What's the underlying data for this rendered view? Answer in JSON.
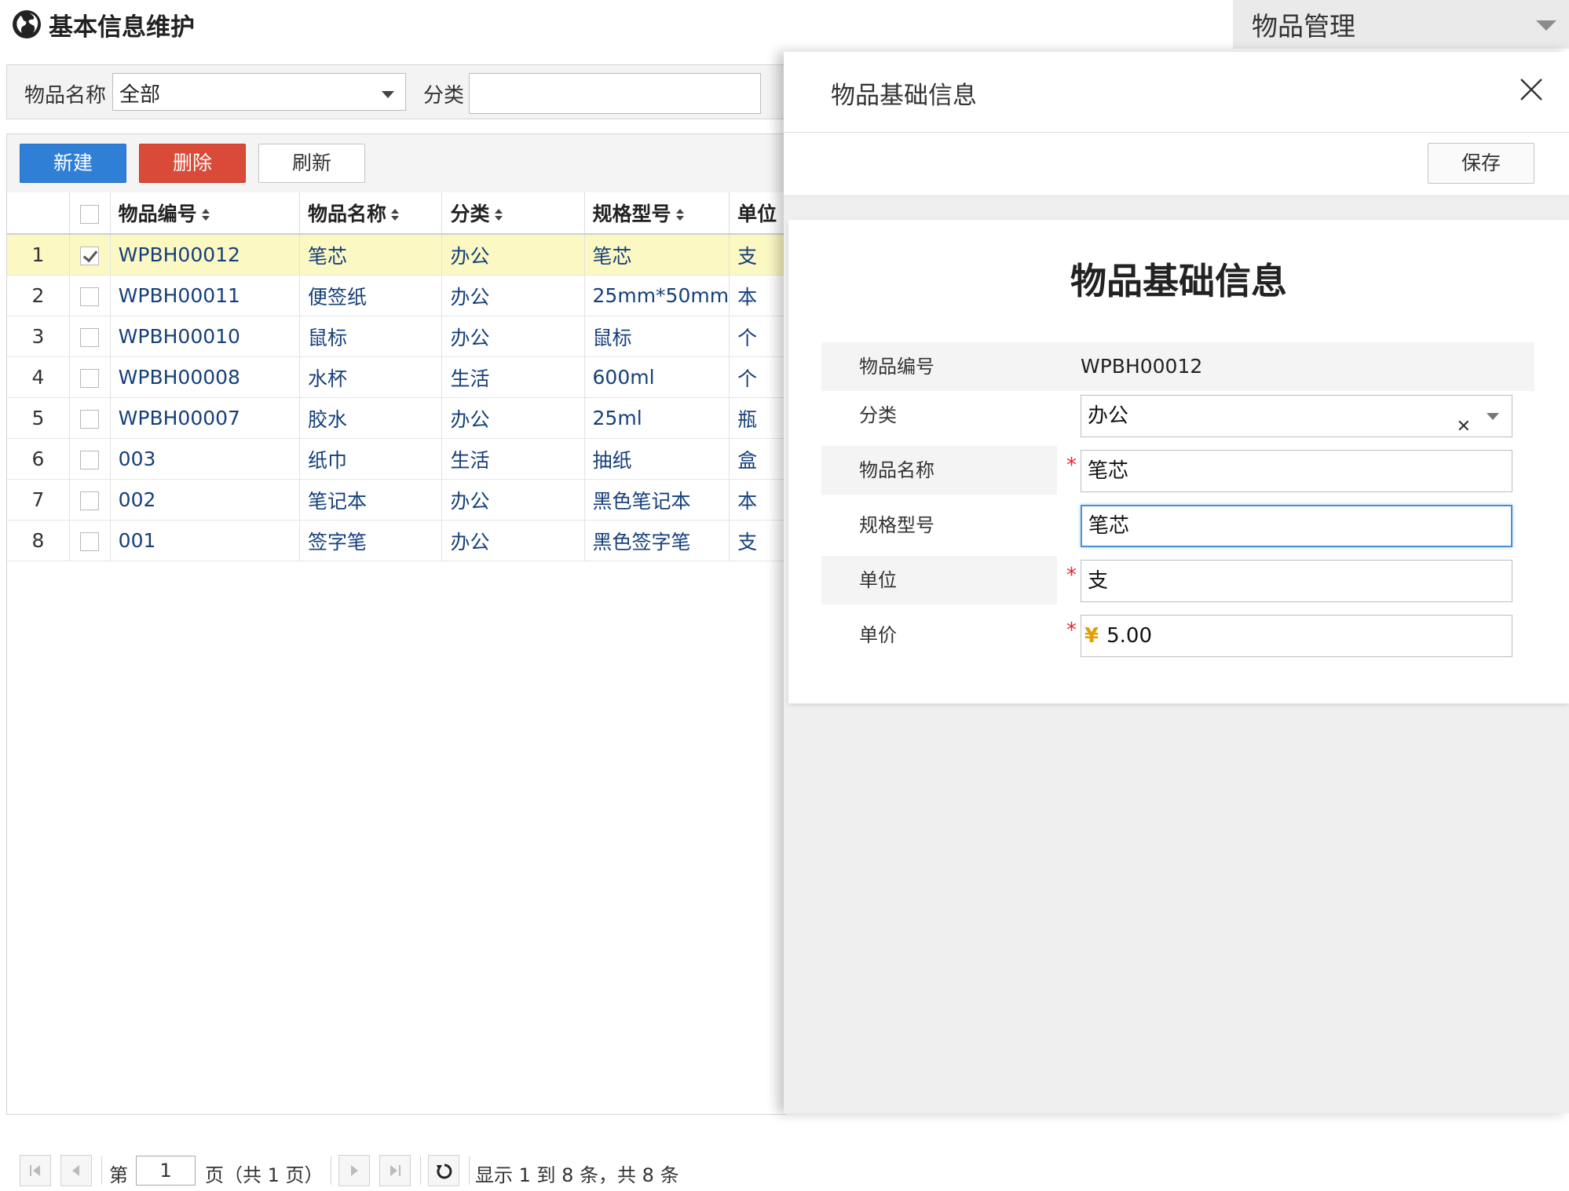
{
  "header": {
    "page_title": "基本信息维护",
    "module_select": "物品管理"
  },
  "filter": {
    "name_label": "物品名称",
    "name_value": "全部",
    "category_label": "分类",
    "category_value": ""
  },
  "toolbar": {
    "new_label": "新建",
    "delete_label": "删除",
    "refresh_label": "刷新"
  },
  "grid": {
    "columns": [
      "物品编号",
      "物品名称",
      "分类",
      "规格型号",
      "单位"
    ],
    "rows": [
      {
        "num": "1",
        "checked": true,
        "code": "WPBH00012",
        "name": "笔芯",
        "category": "办公",
        "spec": "笔芯",
        "unit": "支"
      },
      {
        "num": "2",
        "checked": false,
        "code": "WPBH00011",
        "name": "便签纸",
        "category": "办公",
        "spec": "25mm*50mm",
        "unit": "本"
      },
      {
        "num": "3",
        "checked": false,
        "code": "WPBH00010",
        "name": "鼠标",
        "category": "办公",
        "spec": "鼠标",
        "unit": "个"
      },
      {
        "num": "4",
        "checked": false,
        "code": "WPBH00008",
        "name": "水杯",
        "category": "生活",
        "spec": "600ml",
        "unit": "个"
      },
      {
        "num": "5",
        "checked": false,
        "code": "WPBH00007",
        "name": "胶水",
        "category": "办公",
        "spec": "25ml",
        "unit": "瓶"
      },
      {
        "num": "6",
        "checked": false,
        "code": "003",
        "name": "纸巾",
        "category": "生活",
        "spec": "抽纸",
        "unit": "盒"
      },
      {
        "num": "7",
        "checked": false,
        "code": "002",
        "name": "笔记本",
        "category": "办公",
        "spec": "黑色笔记本",
        "unit": "本"
      },
      {
        "num": "8",
        "checked": false,
        "code": "001",
        "name": "签字笔",
        "category": "办公",
        "spec": "黑色签字笔",
        "unit": "支"
      }
    ]
  },
  "pager": {
    "page_prefix": "第",
    "page_value": "1",
    "page_suffix": "页（共 1 页）",
    "summary": "显示 1 到 8 条，共 8 条"
  },
  "panel": {
    "title": "物品基础信息",
    "save_label": "保存",
    "form_title": "物品基础信息",
    "fields": {
      "code_label": "物品编号",
      "code_value": "WPBH00012",
      "category_label": "分类",
      "category_value": "办公",
      "name_label": "物品名称",
      "name_value": "笔芯",
      "spec_label": "规格型号",
      "spec_value": "笔芯",
      "unit_label": "单位",
      "unit_value": "支",
      "price_label": "单价",
      "price_currency": "¥",
      "price_value": "5.00"
    }
  }
}
